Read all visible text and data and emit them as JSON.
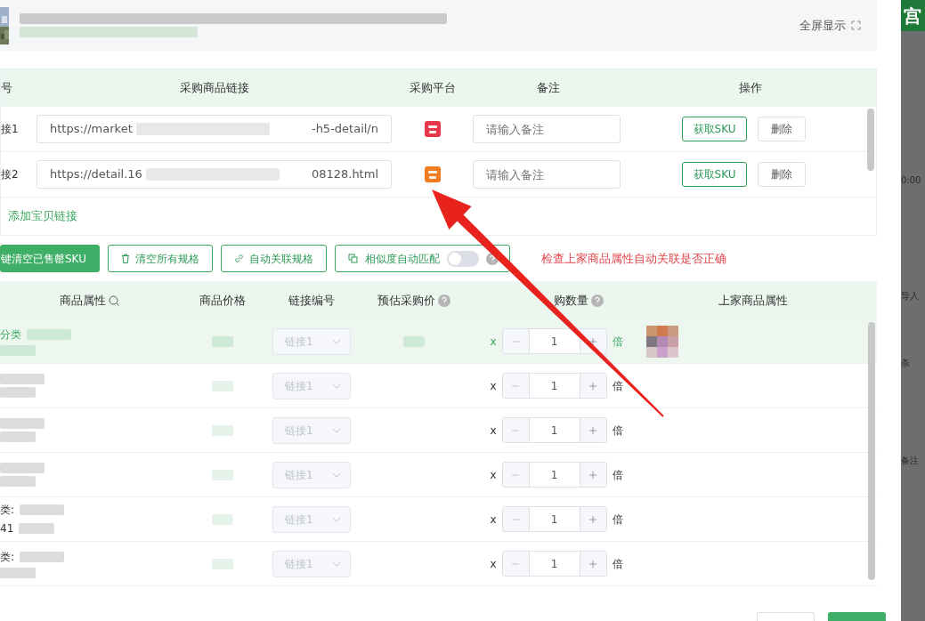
{
  "header": {
    "fullscreen_label": "全屏显示"
  },
  "link_table": {
    "columns": [
      "号",
      "采购商品链接",
      "采购平台",
      "备注",
      "操作"
    ],
    "rows": [
      {
        "index": "接1",
        "url_start": "https://market",
        "url_end": "-h5-detail/n",
        "color": "#e8364a",
        "note_placeholder": "请输入备注",
        "fetch_button": "获取SKU",
        "delete_button": "删除"
      },
      {
        "index": "接2",
        "url_start": "https://detail.16",
        "url_end": "08128.html",
        "color": "#f47c20",
        "note_placeholder": "请输入备注",
        "fetch_button": "获取SKU",
        "delete_button": "删除"
      }
    ],
    "add_link": "添加宝贝链接"
  },
  "toolbar": {
    "buttons": [
      {
        "kind": "primary",
        "label": "键清空已售罄SKU"
      },
      {
        "kind": "trash",
        "label": "清空所有规格"
      },
      {
        "kind": "link",
        "label": "自动关联规格"
      },
      {
        "kind": "toggle",
        "label": "相似度自动匹配",
        "on": false
      }
    ],
    "warning": "检查上家商品属性自动关联是否正确"
  },
  "sku_table": {
    "columns": [
      {
        "label": "商品属性",
        "kind": "search"
      },
      {
        "label": "商品价格",
        "kind": "plain"
      },
      {
        "label": "链接编号",
        "kind": "plain"
      },
      {
        "label": "预估采购价",
        "kind": "help"
      },
      {
        "label": "购数量",
        "kind": "help"
      },
      {
        "label": "上家商品属性",
        "kind": "plain"
      }
    ],
    "rows": [
      {
        "selected": true,
        "attr": [
          "分类"
        ],
        "link": "链接1",
        "estimate_blurred": true,
        "multiply": "x",
        "quantity": "1",
        "unit": "倍",
        "upstream_blurred": true
      },
      {
        "selected": false,
        "link": "链接1",
        "estimate_blurred": false,
        "multiply": "x",
        "quantity": "1",
        "unit": "倍",
        "upstream_blurred": false
      },
      {
        "selected": false,
        "link": "链接1",
        "estimate_blurred": false,
        "multiply": "x",
        "quantity": "1",
        "unit": "倍",
        "upstream_blurred": false
      },
      {
        "selected": false,
        "link": "链接1",
        "estimate_blurred": false,
        "multiply": "x",
        "quantity": "1",
        "unit": "倍",
        "upstream_blurred": false
      },
      {
        "selected": false,
        "attr": [
          "类:",
          "41"
        ],
        "link": "链接1",
        "estimate_blurred": false,
        "multiply": "x",
        "quantity": "1",
        "unit": "倍",
        "upstream_blurred": false
      },
      {
        "selected": false,
        "attr": [
          "类:"
        ],
        "link": "链接1",
        "estimate_blurred": false,
        "multiply": "x",
        "quantity": "1",
        "unit": "倍",
        "upstream_blurred": false
      }
    ]
  },
  "background_page": {
    "logo": "宫",
    "texts": [
      "0:00",
      "导入",
      "条",
      "备注"
    ]
  }
}
